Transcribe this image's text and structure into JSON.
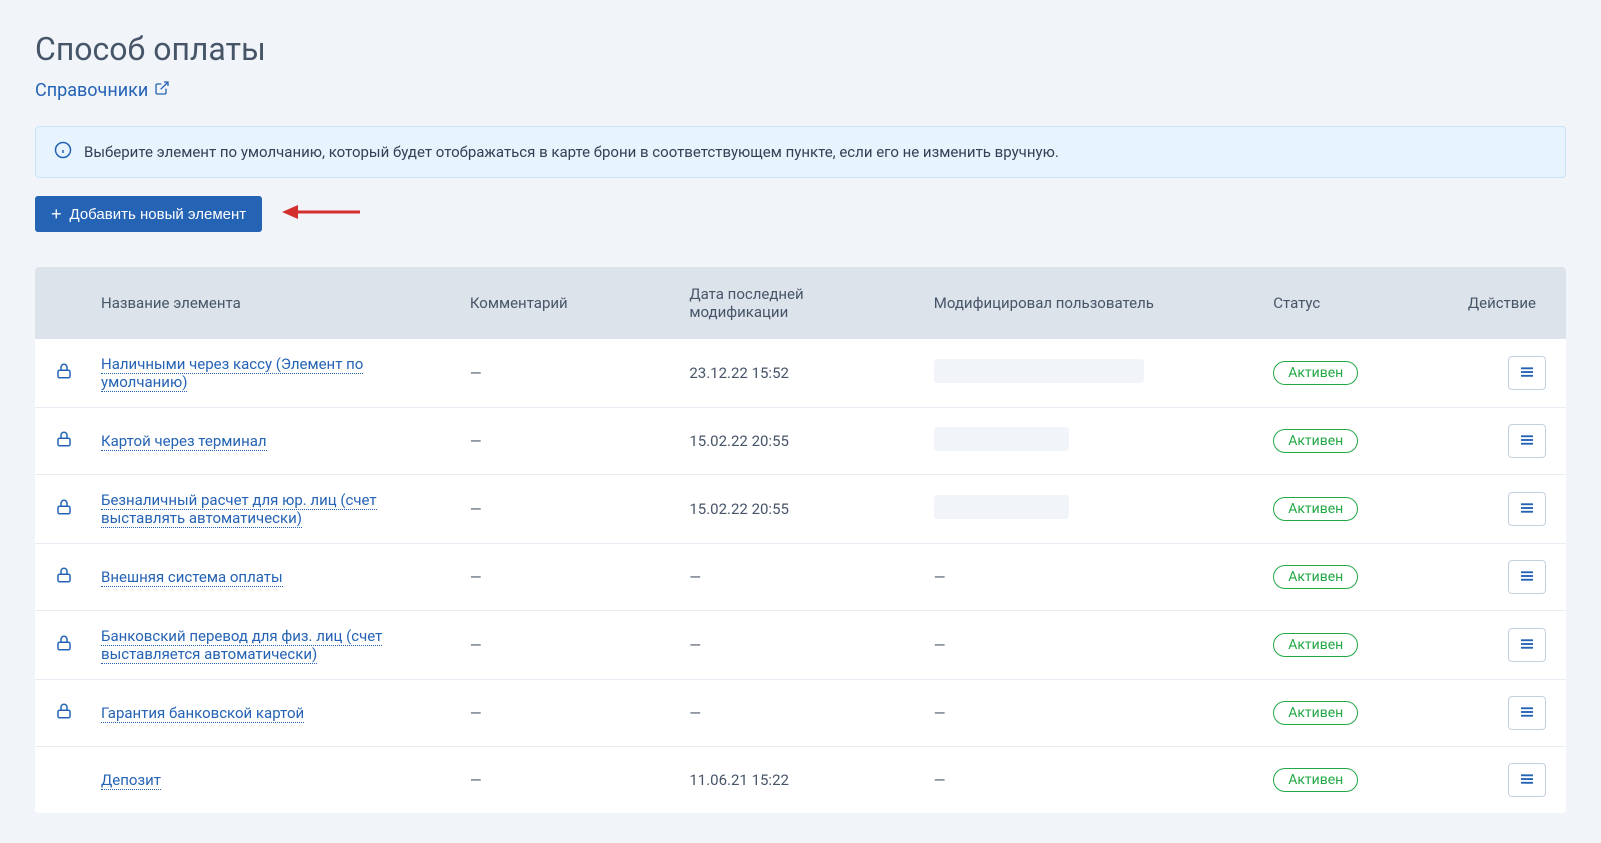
{
  "page": {
    "title": "Способ оплаты",
    "breadcrumb_label": "Справочники"
  },
  "info_banner": {
    "text": "Выберите элемент по умолчанию, который будет отображаться в карте брони в соответствующем пункте, если его не изменить вручную."
  },
  "actions": {
    "add_button_label": "Добавить новый элемент"
  },
  "table": {
    "headers": {
      "name": "Название элемента",
      "comment": "Комментарий",
      "date": "Дата последней модификации",
      "user": "Модифицировал пользователь",
      "status": "Статус",
      "action": "Действие"
    },
    "rows": [
      {
        "locked": true,
        "name": "Наличными через кассу (Элемент по умолчанию)",
        "comment": "—",
        "date": "23.12.22 15:52",
        "user_redacted": "w1",
        "user": "",
        "status": "Активен"
      },
      {
        "locked": true,
        "name": "Картой через терминал",
        "comment": "—",
        "date": "15.02.22 20:55",
        "user_redacted": "w2",
        "user": "",
        "status": "Активен"
      },
      {
        "locked": true,
        "name": "Безналичный расчет для юр. лиц (счет выставлять автоматически)",
        "comment": "—",
        "date": "15.02.22 20:55",
        "user_redacted": "w2",
        "user": "",
        "status": "Активен"
      },
      {
        "locked": true,
        "name": "Внешняя система оплаты",
        "comment": "—",
        "date": "—",
        "user_redacted": "",
        "user": "—",
        "status": "Активен"
      },
      {
        "locked": true,
        "name": "Банковский перевод для физ. лиц (счет выставляется автоматически)",
        "comment": "—",
        "date": "—",
        "user_redacted": "",
        "user": "—",
        "status": "Активен"
      },
      {
        "locked": true,
        "name": "Гарантия банковской картой",
        "comment": "—",
        "date": "—",
        "user_redacted": "",
        "user": "—",
        "status": "Активен"
      },
      {
        "locked": false,
        "name": "Депозит",
        "comment": "—",
        "date": "11.06.21 15:22",
        "user_redacted": "",
        "user": "—",
        "status": "Активен"
      }
    ]
  }
}
